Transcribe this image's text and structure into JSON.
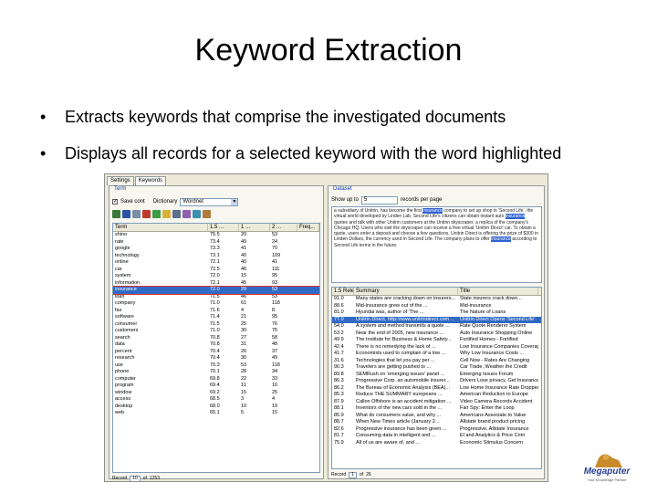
{
  "slide": {
    "title": "Keyword Extraction",
    "bullets": [
      "Extracts keywords that comprise the investigated documents",
      "Displays all records for a selected keyword with the word highlighted"
    ]
  },
  "app": {
    "tabs": [
      "Settings",
      "Keywords"
    ],
    "left": {
      "group_label": "Term",
      "option_checkbox_label": "Save cont",
      "dictionary_label": "Dictionary",
      "dictionary_value": "Wordnet",
      "columns": [
        "Term",
        "1.5 ...",
        "1 ...",
        "2 ...",
        "Freq..."
      ],
      "rows": [
        [
          "shino",
          "75.5",
          "20",
          "53"
        ],
        [
          "rate",
          "73.4",
          "49",
          "24"
        ],
        [
          "google",
          "73.3",
          "41",
          "70"
        ],
        [
          "technology",
          "73.1",
          "40",
          "109"
        ],
        [
          "online",
          "72.1",
          "40",
          "41"
        ],
        [
          "car",
          "72.5",
          "46",
          "111"
        ],
        [
          "system",
          "72.0",
          "15",
          "95"
        ],
        [
          "information",
          "72.1",
          "45",
          "93"
        ],
        [
          "insurance",
          "72.0",
          "29",
          "53"
        ],
        [
          "loan",
          "71.5",
          "46",
          "53"
        ],
        [
          "company",
          "71.0",
          "61",
          "118"
        ],
        [
          "fax",
          "71.6",
          "4",
          "8"
        ],
        [
          "software",
          "71.4",
          "21",
          "95"
        ],
        [
          "consumer",
          "71.5",
          "25",
          "76"
        ],
        [
          "customers",
          "71.0",
          "30",
          "75"
        ],
        [
          "search",
          "70.8",
          "27",
          "58"
        ],
        [
          "data",
          "70.8",
          "31",
          "48"
        ],
        [
          "percent",
          "70.4",
          "26",
          "37"
        ],
        [
          "research",
          "70.4",
          "30",
          "49"
        ],
        [
          "use",
          "70.3",
          "53",
          "118"
        ],
        [
          "phone",
          "70.1",
          "28",
          "34"
        ],
        [
          "computer",
          "69.8",
          "22",
          "33"
        ],
        [
          "program",
          "69.4",
          "11",
          "16"
        ],
        [
          "window",
          "69.2",
          "15",
          "25"
        ],
        [
          "access",
          "68.5",
          "3",
          "4"
        ],
        [
          "desktop",
          "68.0",
          "10",
          "19"
        ],
        [
          "web",
          "65.1",
          "5",
          "15"
        ]
      ],
      "selected_index": 8,
      "record_label": "Record",
      "record_value": "10",
      "of_label": "of",
      "of_value": "1253"
    },
    "right": {
      "group_label": "Dataset",
      "show_label": "Show up to",
      "show_value": "5",
      "per_page_label": "records per page",
      "text_before": "a subsidiary of Unitrin, has become the first ",
      "text_highlight1": "insurance",
      "text_middle1": " company to set up shop in 'Second Life', the virtual world developed by Linden Lab. Second Life's citizens can obtain instant auto ",
      "text_highlight2": "insurance",
      "text_middle2": " quotes and talk with other Unitrin customers at the Unitrin skyscraper, a replica of the company's Chicago HQ. Users who visit the skyscraper can receive a free virtual 'Unitrin Direct' car. To obtain a quote, users enter a deposit and choose a few questions. Unitrin Direct is offering the prize of $300 in Linden Dollars, the currency used in Second Life. The company plans to offer ",
      "text_highlight3": "insurance",
      "text_after": " according to Second Life terms in the future.",
      "columns": [
        "1.5 Rele...",
        "Summary",
        "Title"
      ],
      "rows": [
        [
          "91.0",
          "Many states are cracking down on insurers...",
          "State insurers crack down..."
        ],
        [
          "88.6",
          "Mid-insurance grew out of the ...",
          "Mid-insurance"
        ],
        [
          "81.0",
          "Hyundai was, author of 'The ...",
          "The Nature of Loans"
        ],
        [
          "77.0",
          "Unitrin Direct, http://www.unitrindirect.com ...",
          "Unitrin Direct Opens 'Second Life'"
        ],
        [
          "54.0",
          "A system and method transmits a quote ...",
          "Rate Quote Renderer System"
        ],
        [
          "53.2",
          "Near the end of 2005, new insurance ...",
          "Auto Insurance Shopping Online"
        ],
        [
          "49.9",
          "The Institute for Business & Home Safety...",
          "Fortified Homes - Fortified"
        ],
        [
          "42.4",
          "There is no remedying the lack of ...",
          "Low Insurance Companies Coverage"
        ],
        [
          "41.7",
          "Economists used to complain of a low ...",
          "Why Low Insurance Costs ..."
        ],
        [
          "31.6",
          "Technologies that let you pay per ...",
          "Cell Now - Rates Are Changing"
        ],
        [
          "90.3",
          "Travelers are getting pushed to ...",
          "Car Trade, Weather the Credit"
        ],
        [
          "89.8",
          "SEMRush on 'emerging issues' panel ...",
          "Emerging Issues Forum"
        ],
        [
          "86.3",
          "Progressive Corp. an automobile insurer...",
          "Drivers Lose privacy, Get Insurance"
        ],
        [
          "86.2",
          "The Bureau of Economic Analysis (BEA)...",
          "Low Home Insurance Rate Dropped"
        ],
        [
          "85.3",
          "Reduce THE SUMMARY europeans ...",
          "American Reduction to Europe"
        ],
        [
          "87.9",
          "Callon Offshore is an accident mitigation ...",
          "Video Camera Records Accident"
        ],
        [
          "88.1",
          "Inventors of the new cars sold in the ...",
          "Fair Spy: Enter the Loop"
        ],
        [
          "85.9",
          "What do consumers value, and why ...",
          "Americans Associate to Value"
        ],
        [
          "88.7",
          "When New Times article (January 2...",
          "Allstate brand product pricing"
        ],
        [
          "82.6",
          "Progressive insurance has been given ...",
          "Progressive, Allstate Insurance"
        ],
        [
          "81.7",
          "Consuming data in intelligent and ...",
          "El and Analytics & Price Crim"
        ],
        [
          "75.9",
          "All of us are aware of, and ...",
          "Economic Stimulus Concern"
        ]
      ],
      "selected_index": 3,
      "record_label": "Record",
      "record_value": "1",
      "of_label": "of",
      "of_value": "26"
    }
  },
  "logo": {
    "name": "Megaputer",
    "tagline": "Your Knowledge Partner"
  },
  "colors": {
    "selection": "#316ac5",
    "highlight": "#2f62d0",
    "window_bg": "#ece9d8",
    "group_label": "#1a3fa8"
  }
}
